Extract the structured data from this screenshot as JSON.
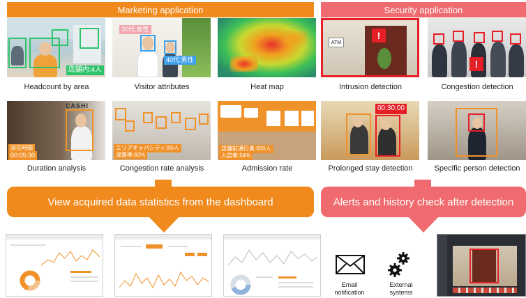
{
  "sections": {
    "marketing": "Marketing application",
    "security": "Security application"
  },
  "tiles": [
    {
      "caption": "Headcount by area",
      "overlay": "店舗内:4人"
    },
    {
      "caption": "Visitor attributes",
      "overlay1": "30代:女性",
      "overlay2": "40代:男性"
    },
    {
      "caption": "Heat map"
    },
    {
      "caption": "Intrusion detection",
      "sign": "ATM",
      "alert": "!"
    },
    {
      "caption": "Congestion detection",
      "alert": "!"
    },
    {
      "caption": "Duration analysis",
      "overlay1": "滞在時間",
      "overlay2": "00:05:30",
      "store_sign": "CASHI"
    },
    {
      "caption": "Congestion rate analysis",
      "overlay1": "エリアキャパシティ:80人",
      "overlay2": "混雑率:60%"
    },
    {
      "caption": "Admission rate",
      "overlay1": "店舗前通行者:560人",
      "overlay2": "入店率:54%"
    },
    {
      "caption": "Prolonged stay detection",
      "timer": "00:30:00"
    },
    {
      "caption": "Specific person detection"
    }
  ],
  "banners": {
    "marketing": "View acquired data statistics from the dashboard",
    "security": "Alerts and history check after detection"
  },
  "notifications": {
    "email": [
      "Email",
      "notification"
    ],
    "external": [
      "External",
      "systems"
    ]
  },
  "colors": {
    "marketing_orange": "#f08a1c",
    "security_pink": "#f06b6f",
    "detect_green": "#2ec36a",
    "detect_blue": "#3fa0ea",
    "detect_orange": "#f0922a",
    "alert_red": "#e61e25"
  }
}
